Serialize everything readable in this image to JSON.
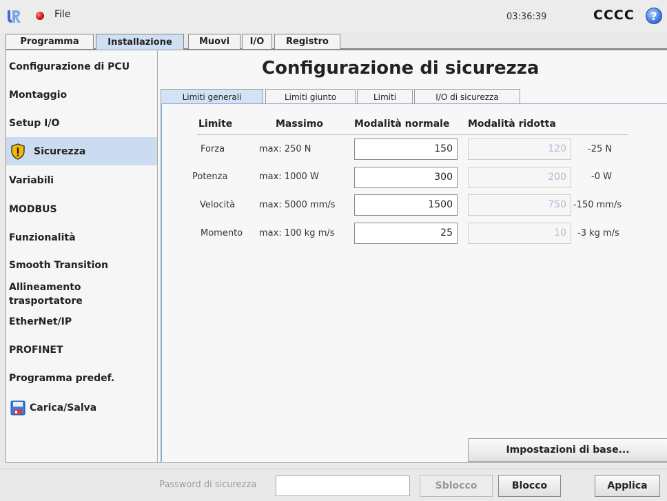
{
  "topbar": {
    "file_label": "File",
    "clock": "03:36:39",
    "robot_name": "CCCC",
    "help_glyph": "?"
  },
  "main_tabs": [
    "Programma",
    "Installazione",
    "Muovi",
    "I/O",
    "Registro"
  ],
  "active_main_tab": "Installazione",
  "sidebar": {
    "items": [
      {
        "label": "Configurazione di PCU"
      },
      {
        "label": "Montaggio"
      },
      {
        "label": "Setup I/O"
      },
      {
        "label": "Sicurezza",
        "icon": "warning-shield-icon"
      },
      {
        "label": "Variabili"
      },
      {
        "label": "MODBUS"
      },
      {
        "label": "Funzionalità"
      },
      {
        "label": "Smooth Transition"
      },
      {
        "label": "Allineamento\ntrasportatore"
      },
      {
        "label": "EtherNet/IP"
      },
      {
        "label": "PROFINET"
      },
      {
        "label": "Programma predef."
      },
      {
        "label": "Carica/Salva",
        "icon": "floppy-disk-icon"
      }
    ],
    "active": "Sicurezza"
  },
  "page": {
    "title": "Configurazione di sicurezza",
    "subtabs": [
      "Limiti generali",
      "Limiti giunto",
      "Limiti",
      "I/O di sicurezza"
    ],
    "active_subtab": "Limiti generali"
  },
  "table": {
    "headers": [
      "Limite",
      "Massimo",
      "Modalità normale",
      "Modalità ridotta"
    ],
    "rows": [
      {
        "name": "Forza",
        "max": "max: 250 N",
        "normal": "150",
        "reduced": "120",
        "delta": "-25 N"
      },
      {
        "name": "Potenza",
        "max": "max: 1000 W",
        "normal": "300",
        "reduced": "200",
        "delta": "-0 W"
      },
      {
        "name": "Velocità",
        "max": "max: 5000 mm/s",
        "normal": "1500",
        "reduced": "750",
        "delta": "-150 mm/s"
      },
      {
        "name": "Momento",
        "max": "max: 100 kg m/s",
        "normal": "25",
        "reduced": "10",
        "delta": "-3 kg m/s"
      }
    ]
  },
  "defaults_button": "Impostazioni di base...",
  "bottom": {
    "password_label": "Password di sicurezza",
    "password_value": "",
    "unlock": "Sblocco",
    "lock": "Blocco",
    "apply": "Applica"
  },
  "colors": {
    "accent": "#cbdcf0",
    "warning": "#f5b800",
    "status_dot": "#e02020",
    "disabled_text": "#aebfd8"
  }
}
